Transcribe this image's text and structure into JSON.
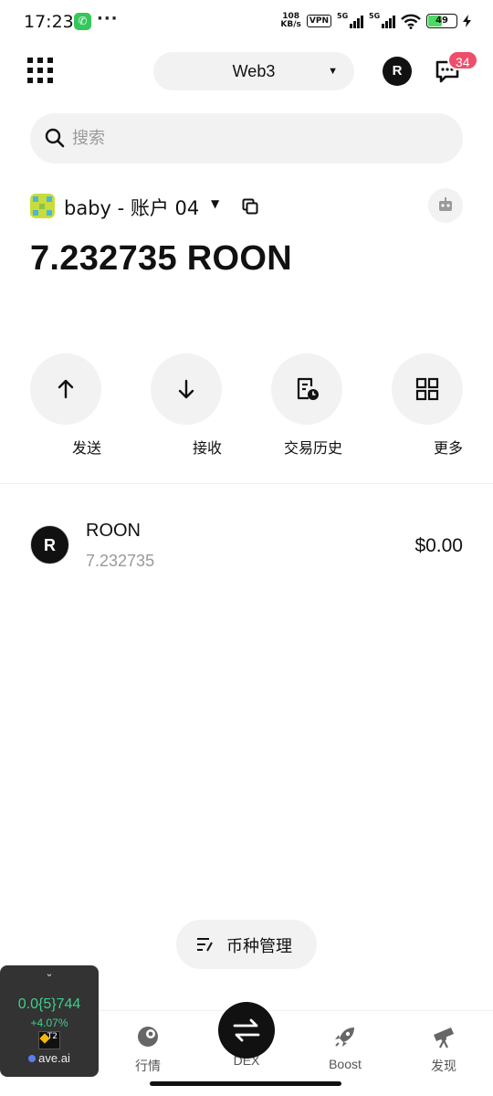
{
  "status_bar": {
    "time": "17:23",
    "more": "···",
    "speed_value": "108",
    "speed_unit": "KB/s",
    "vpn": "VPN",
    "sim1": "5G",
    "sim2": "5G",
    "battery": "49"
  },
  "header": {
    "network_label": "Web3",
    "account_initial": "R",
    "notification_count": "34"
  },
  "search": {
    "placeholder": "搜索"
  },
  "account": {
    "name": "baby - 账户 04"
  },
  "balance": "7.232735 ROON",
  "actions": [
    {
      "label": "发送",
      "icon": "arrow-up-icon"
    },
    {
      "label": "接收",
      "icon": "arrow-down-icon"
    },
    {
      "label": "交易历史",
      "icon": "history-icon"
    },
    {
      "label": "更多",
      "icon": "grid-icon"
    }
  ],
  "tokens": [
    {
      "logo": "R",
      "symbol": "ROON",
      "amount": "7.232735",
      "value": "$0.00"
    }
  ],
  "manage_label": "币种管理",
  "bottom_nav": [
    {
      "label": "行情",
      "icon": "market-icon"
    },
    {
      "label": "DEX",
      "icon": "swap-icon"
    },
    {
      "label": "Boost",
      "icon": "rocket-icon"
    },
    {
      "label": "发现",
      "icon": "telescope-icon"
    }
  ],
  "widget": {
    "price": "0.0{5}744",
    "change": "+4.07%",
    "coin_label": "T2",
    "brand": "ave.ai"
  },
  "colors": {
    "accent": "#111111",
    "badge": "#ef4e6a",
    "positive": "#3ecf8e",
    "surface": "#f2f2f2"
  }
}
